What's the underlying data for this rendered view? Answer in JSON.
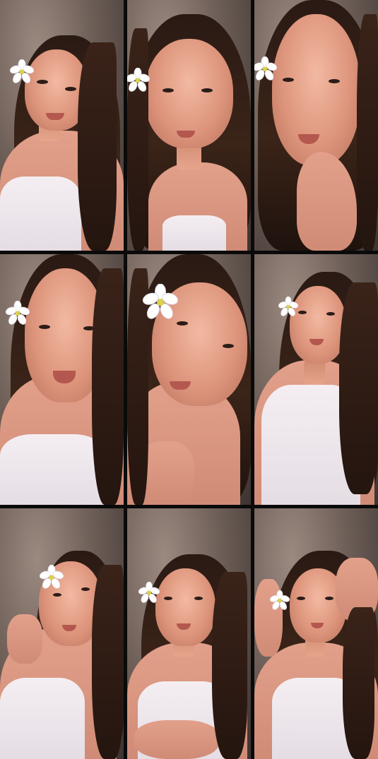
{
  "screen": {
    "description_visible_text": ""
  },
  "photo_grid": {
    "rows": 3,
    "columns": 3,
    "frames": [
      {
        "id": "frame-1",
        "flower_accessory": "white-flower-icon"
      },
      {
        "id": "frame-2",
        "flower_accessory": "white-flower-icon"
      },
      {
        "id": "frame-3",
        "flower_accessory": "white-flower-icon"
      },
      {
        "id": "frame-4",
        "flower_accessory": "white-flower-icon"
      },
      {
        "id": "frame-5",
        "flower_accessory": "white-flower-icon"
      },
      {
        "id": "frame-6",
        "flower_accessory": "white-flower-icon"
      },
      {
        "id": "frame-7",
        "flower_accessory": "white-flower-icon"
      },
      {
        "id": "frame-8",
        "flower_accessory": "white-flower-icon"
      },
      {
        "id": "frame-9",
        "flower_accessory": "white-flower-icon"
      }
    ]
  },
  "colors": {
    "separator": "#0a0a0a",
    "background_wall": "#6e5f58",
    "hair": "#2a1a14",
    "skin": "#e6a58b",
    "top": "#f1ebf0",
    "flower_petal": "#ffffff",
    "flower_center": "#d9d24a"
  }
}
